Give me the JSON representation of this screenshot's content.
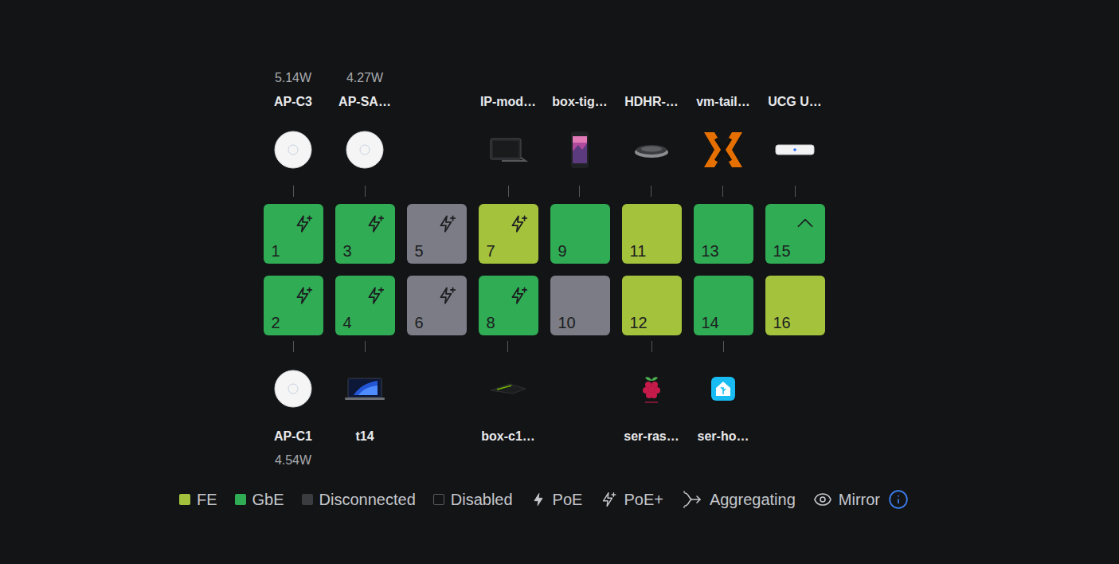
{
  "ports": [
    {
      "number": "1",
      "speed": "GbE",
      "color": "#2fac54",
      "poe": "PoE+",
      "uplink": false,
      "device": {
        "name": "AP-C3",
        "power": "5.14W",
        "kind": "ap"
      }
    },
    {
      "number": "2",
      "speed": "GbE",
      "color": "#2fac54",
      "poe": "PoE+",
      "uplink": false,
      "device": {
        "name": "AP-C1",
        "power": "4.54W",
        "kind": "ap"
      }
    },
    {
      "number": "3",
      "speed": "GbE",
      "color": "#2fac54",
      "poe": "PoE+",
      "uplink": false,
      "device": {
        "name": "AP-SA…",
        "power": "4.27W",
        "kind": "ap"
      }
    },
    {
      "number": "4",
      "speed": "GbE",
      "color": "#2fac54",
      "poe": "PoE+",
      "uplink": false,
      "device": {
        "name": "t14",
        "power": "",
        "kind": "laptop"
      }
    },
    {
      "number": "5",
      "speed": "Disconnected",
      "color": "#7b7c85",
      "poe": "PoE+",
      "uplink": false,
      "device": null
    },
    {
      "number": "6",
      "speed": "Disconnected",
      "color": "#7b7c85",
      "poe": "PoE+",
      "uplink": false,
      "device": null
    },
    {
      "number": "7",
      "speed": "FE",
      "color": "#a4c23c",
      "poe": "PoE+",
      "uplink": false,
      "device": {
        "name": "IP-mod…",
        "power": "",
        "kind": "ipmodule"
      }
    },
    {
      "number": "8",
      "speed": "GbE",
      "color": "#2fac54",
      "poe": "PoE+",
      "uplink": false,
      "device": {
        "name": "box-c1…",
        "power": "",
        "kind": "shield"
      }
    },
    {
      "number": "9",
      "speed": "GbE",
      "color": "#2fac54",
      "poe": "",
      "uplink": false,
      "device": {
        "name": "box-tig…",
        "power": "",
        "kind": "phone"
      }
    },
    {
      "number": "10",
      "speed": "Disconnected",
      "color": "#7b7c85",
      "poe": "",
      "uplink": false,
      "device": null
    },
    {
      "number": "11",
      "speed": "FE",
      "color": "#a4c23c",
      "poe": "",
      "uplink": false,
      "device": {
        "name": "HDHR-…",
        "power": "",
        "kind": "tuner"
      }
    },
    {
      "number": "12",
      "speed": "FE",
      "color": "#a4c23c",
      "poe": "",
      "uplink": false,
      "device": {
        "name": "ser-ras…",
        "power": "",
        "kind": "raspberry"
      }
    },
    {
      "number": "13",
      "speed": "GbE",
      "color": "#2fac54",
      "poe": "",
      "uplink": false,
      "device": {
        "name": "vm-tail…",
        "power": "",
        "kind": "proxmox"
      }
    },
    {
      "number": "14",
      "speed": "GbE",
      "color": "#2fac54",
      "poe": "",
      "uplink": false,
      "device": {
        "name": "ser-ho…",
        "power": "",
        "kind": "homeassistant"
      }
    },
    {
      "number": "15",
      "speed": "GbE",
      "color": "#2fac54",
      "poe": "",
      "uplink": true,
      "device": {
        "name": "UCG U…",
        "power": "",
        "kind": "gateway"
      }
    },
    {
      "number": "16",
      "speed": "FE",
      "color": "#a4c23c",
      "poe": "",
      "uplink": false,
      "device": null
    }
  ],
  "legend": [
    {
      "label": "FE",
      "kind": "swatch",
      "color": "#a4c23c"
    },
    {
      "label": "GbE",
      "kind": "swatch",
      "color": "#2fac54"
    },
    {
      "label": "Disconnected",
      "kind": "swatch",
      "color": "#3b3c40"
    },
    {
      "label": "Disabled",
      "kind": "outline",
      "color": "#131416"
    },
    {
      "label": "PoE",
      "kind": "poe",
      "color": "#c5c7cc"
    },
    {
      "label": "PoE+",
      "kind": "poe-plus",
      "color": "#c5c7cc"
    },
    {
      "label": "Aggregating",
      "kind": "aggregating",
      "color": "#c5c7cc"
    },
    {
      "label": "Mirror",
      "kind": "mirror",
      "color": "#c5c7cc"
    }
  ]
}
